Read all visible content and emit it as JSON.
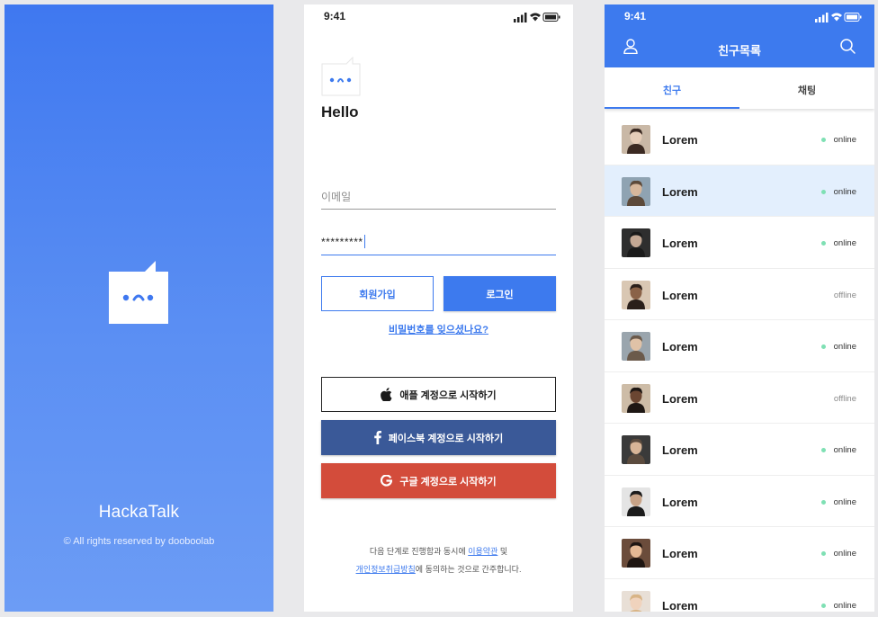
{
  "splash": {
    "app_name": "HackaTalk",
    "copyright": "© All rights reserved by dooboolab"
  },
  "status_bar": {
    "time": "9:41"
  },
  "login": {
    "greeting": "Hello",
    "email_placeholder": "이메일",
    "password_value": "*********",
    "signup_label": "회원가입",
    "login_label": "로그인",
    "forgot_password": "비밀번호를 잊으셨나요?",
    "apple_label": "애플 계정으로 시작하기",
    "facebook_label": "페이스북 계정으로 시작하기",
    "google_label": "구글 계정으로 시작하기",
    "terms": {
      "line1_prefix": "다음 단계로 진행함과 동시에 ",
      "terms_link": "이용약관",
      "line1_suffix": " 및",
      "privacy_link": "개인정보취급방침",
      "line2_suffix": "에 동의하는 것으로 간주합니다."
    }
  },
  "friends": {
    "title": "친구목록",
    "tabs": [
      {
        "label": "친구",
        "active": true
      },
      {
        "label": "채팅",
        "active": false
      }
    ],
    "items": [
      {
        "name": "Lorem",
        "status": "online"
      },
      {
        "name": "Lorem",
        "status": "online"
      },
      {
        "name": "Lorem",
        "status": "online"
      },
      {
        "name": "Lorem",
        "status": "offline"
      },
      {
        "name": "Lorem",
        "status": "online"
      },
      {
        "name": "Lorem",
        "status": "offline"
      },
      {
        "name": "Lorem",
        "status": "online"
      },
      {
        "name": "Lorem",
        "status": "online"
      },
      {
        "name": "Lorem",
        "status": "online"
      },
      {
        "name": "Lorem",
        "status": "online"
      }
    ]
  },
  "colors": {
    "primary": "#3d7aee",
    "facebook": "#3a5998",
    "google": "#d34c3b",
    "online_dot": "#7fe0b4",
    "highlight_row": "#e3effd"
  }
}
